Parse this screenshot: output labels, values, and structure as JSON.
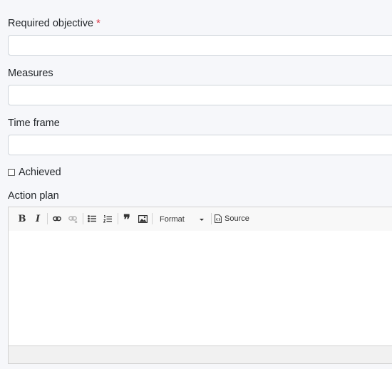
{
  "form": {
    "objective": {
      "label": "Required objective",
      "required_marker": "*",
      "value": ""
    },
    "measures": {
      "label": "Measures",
      "value": ""
    },
    "time_frame": {
      "label": "Time frame",
      "value": ""
    },
    "achieved": {
      "label": "Achieved",
      "checked": false
    },
    "action_plan": {
      "label": "Action plan"
    }
  },
  "editor": {
    "toolbar": {
      "bold": "B",
      "italic": "I",
      "blockquote": "❞",
      "format_label": "Format",
      "source_label": "Source"
    },
    "content": ""
  }
}
